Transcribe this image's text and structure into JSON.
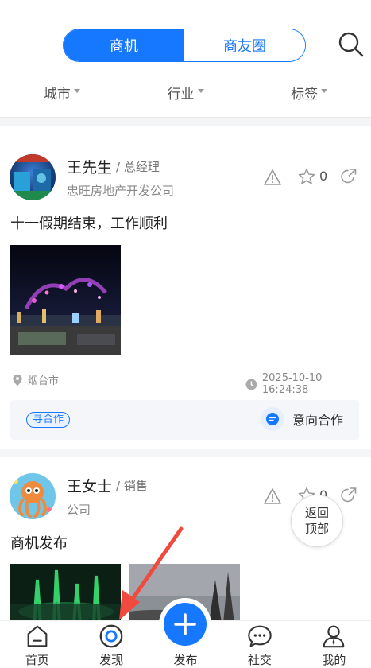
{
  "top_tabs": [
    {
      "label": "商机",
      "active": true
    },
    {
      "label": "商友圈",
      "active": false
    }
  ],
  "filters": [
    {
      "label": "城市"
    },
    {
      "label": "行业"
    },
    {
      "label": "标签"
    }
  ],
  "posts": [
    {
      "name": "王先生",
      "title": "/ 总经理",
      "company": "忠旺房地产开发公司",
      "fav_count": "0",
      "text": "十一假期结束，工作顺利",
      "location": "烟台市",
      "time": "2025-10-10 16:24:38",
      "tag": "寻合作",
      "action": "意向合作"
    },
    {
      "name": "王女士",
      "title": "/ 销售",
      "company": "公司",
      "fav_count": "0",
      "text": "商机发布"
    }
  ],
  "back_to_top": {
    "line1": "返回",
    "line2": "顶部"
  },
  "bottom_nav": [
    {
      "label": "首页",
      "icon": "home-icon"
    },
    {
      "label": "发现",
      "icon": "discover-icon",
      "active": true
    },
    {
      "label": "发布",
      "icon": "plus-icon"
    },
    {
      "label": "社交",
      "icon": "chat-icon"
    },
    {
      "label": "我的",
      "icon": "profile-icon"
    }
  ],
  "colors": {
    "accent": "#1677ff",
    "annotation_arrow": "#f04a3e"
  }
}
